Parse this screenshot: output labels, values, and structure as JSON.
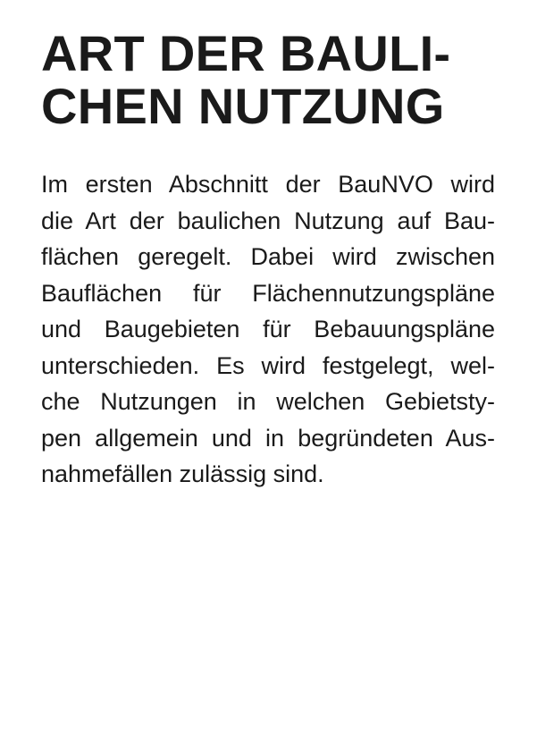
{
  "title_lines": [
    "ART DER BAULI-",
    "CHEN NUTZUNG"
  ],
  "body_lines": [
    "Im ersten Abschnitt der BauNVO wird",
    "die Art der baulichen Nutzung auf Bau-",
    "flächen geregelt. Dabei wird zwischen",
    "Bauflächen für Flächennutzungspläne",
    "und Baugebieten für Bebauungspläne",
    "unterschieden. Es wird festgelegt, wel-",
    "che Nutzungen in welchen Gebietsty-",
    "pen allgemein und in begründeten Aus-",
    "nahmefällen zulässig sind."
  ]
}
